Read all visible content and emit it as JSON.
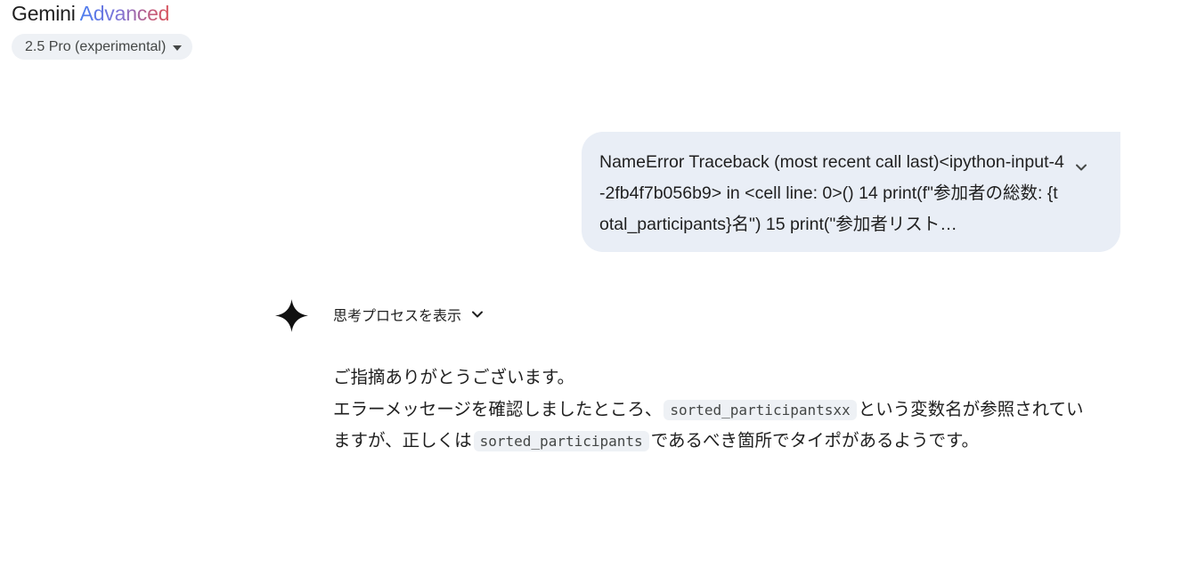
{
  "header": {
    "brand_name": "Gemini",
    "brand_tier": "Advanced",
    "model_selector": "2.5 Pro (experimental)"
  },
  "user_message": {
    "text": "NameError Traceback (most recent call last)<ipython-input-4-2fb4f7b056b9> in <cell line: 0>() 14 print(f\"参加者の総数: {total_participants}名\") 15 print(\"参加者リスト…",
    "expand_icon": "chevron-down-icon"
  },
  "response": {
    "avatar_icon": "gemini-spark-icon",
    "show_thinking_label": "思考プロセスを表示",
    "line1": "ご指摘ありがとうございます。",
    "line2_a": "エラーメッセージを確認しましたところ、",
    "code1": "sorted_participantsxx",
    "line2_b": "という変数名が参照されてい",
    "line3_a": "ますが、正しくは",
    "code2": "sorted_participants",
    "line3_b": "であるべき箇所でタイポがあるようです。"
  },
  "colors": {
    "user_bubble": "#e9eef6",
    "code_bg": "#eef1f5",
    "brand_gradient_start": "#4b7ef0",
    "brand_gradient_end": "#d9545d"
  }
}
